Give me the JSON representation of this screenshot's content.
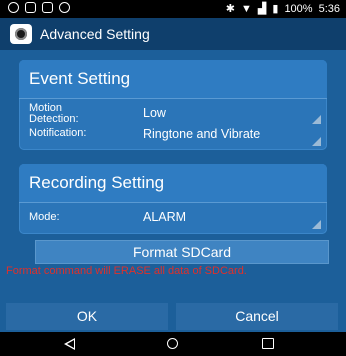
{
  "status_bar": {
    "battery": "100%",
    "time": "5:36"
  },
  "header": {
    "title": "Advanced Setting"
  },
  "event_setting": {
    "heading": "Event Setting",
    "motion_label": "Motion\nDetection:",
    "motion_value": "Low",
    "notification_label": "Notification:",
    "notification_value": "Ringtone and Vibrate"
  },
  "recording_setting": {
    "heading": "Recording Setting",
    "mode_label": "Mode:",
    "mode_value": "ALARM"
  },
  "format_button": "Format SDCard",
  "warning": "Format command will ERASE all data of SDCard.",
  "actions": {
    "ok": "OK",
    "cancel": "Cancel"
  },
  "colors": {
    "background": "#1c5f9a",
    "titlebar": "#0f3f6c",
    "panel": "#2b75b8",
    "warning": "#e0302a"
  },
  "icons": {
    "back": "back-triangle-icon",
    "home": "home-circle-icon",
    "recent": "recent-square-icon",
    "app": "camera-app-icon"
  }
}
